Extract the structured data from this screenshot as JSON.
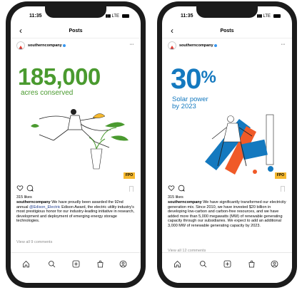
{
  "phones": [
    {
      "status_time": "11:35",
      "status_network": "LTE",
      "nav_title": "Posts",
      "username": "southerncompany",
      "image": {
        "stat": "185,000",
        "stat_color": "#4a9a2f",
        "subtitle": "acres conserved",
        "subtitle_color": "#4a9a2f",
        "badge": "FPO"
      },
      "likes": "315 likes",
      "caption_user": "southerncompany",
      "caption_before": "We have proudly been awarded the 92nd annual ",
      "caption_mention": "@Edison_Electric",
      "caption_after": " Edison Award, the electric utility industry's most prestigious honor for our industry-leading initiative in research, development and deployment of emerging energy storage technologies.",
      "view_comments": "View all 9 comments"
    },
    {
      "status_time": "11:35",
      "status_network": "LTE",
      "nav_title": "Posts",
      "username": "southerncompany",
      "image": {
        "stat_number": "30",
        "stat_unit": "%",
        "stat_color": "#1479bf",
        "subtitle_line1": "Solar power",
        "subtitle_line2": "by 2023",
        "subtitle_color": "#1479bf",
        "badge": "FPO"
      },
      "likes": "315 likes",
      "caption_user": "southerncompany",
      "caption_text": "We have significantly transformed our electricity generation mix. Since 2010, we have invested $20 billion in developing low-carbon and carbon-free resources, and we have added more than 5,000 megawatts (MW) of renewable generating capacity through our subsidiaries. We expect to add an additional 3,000 MW of renewable generating capacity by 2023.",
      "view_comments": "View all 12 comments"
    }
  ],
  "icons": {
    "back": "back-chevron-icon",
    "more": "more-dots-icon",
    "like": "heart-icon",
    "comment": "comment-bubble-icon",
    "save": "bookmark-icon",
    "tabs": [
      "home-icon",
      "search-icon",
      "add-post-icon",
      "shop-bag-icon",
      "profile-icon"
    ]
  },
  "colors": {
    "brand_green": "#4a9a2f",
    "brand_blue": "#1479bf",
    "accent_orange": "#f05a28",
    "badge_yellow": "#f5b82e"
  }
}
